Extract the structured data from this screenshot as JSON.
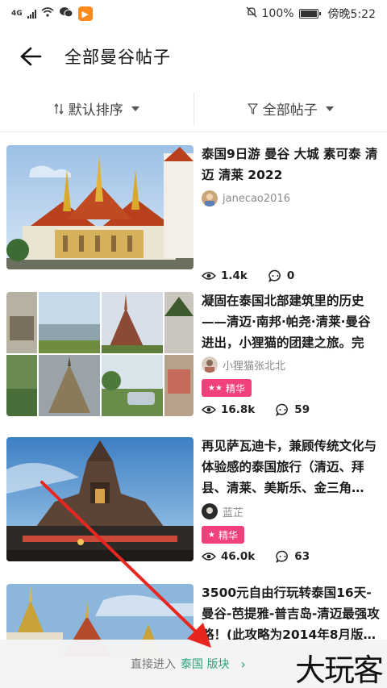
{
  "status_bar": {
    "network": "4G",
    "battery": "100%",
    "time": "傍晚5:22",
    "app_badge": "▶"
  },
  "header": {
    "back_icon": "arrow-left-icon",
    "title": "全部曼谷帖子"
  },
  "filters": {
    "sort_label": "默认排序",
    "filter_label": "全部帖子",
    "sort_icon": "sort-icon",
    "filter_icon": "funnel-icon"
  },
  "posts": [
    {
      "title": "泰国9日游 曼谷 大城 素可泰 清迈 清莱 2022",
      "author": "janecao2016",
      "featured": false,
      "views": "1.4k",
      "comments": "0"
    },
    {
      "title": "凝固在泰国北部建筑里的历史——清迈·南邦·帕尧·清莱·曼谷进出，小狸猫的团建之旅。完结…",
      "author": "小狸猫张北北",
      "featured": true,
      "badge": "精华",
      "views": "16.8k",
      "comments": "59"
    },
    {
      "title": "再见萨瓦迪卡，兼顾传统文化与体验感的泰国旅行（清迈、拜县、清莱、美斯乐、金三角…",
      "author": "蓝芷",
      "featured": true,
      "badge": "精华",
      "views": "46.0k",
      "comments": "63"
    },
    {
      "title": "3500元自由行玩转泰国16天-曼谷-芭提雅-普吉岛-清迈最强攻略！(此攻略为2014年8月版…",
      "author": "",
      "featured": false
    }
  ],
  "bottom_bar": {
    "prefix": "直接进入",
    "link": "泰国 版块",
    "chevron": "›"
  },
  "watermark": "大玩客",
  "colors": {
    "accent_green": "#2aa37f",
    "badge_pink": "#f0417b",
    "annotation_red": "#e8261f"
  }
}
